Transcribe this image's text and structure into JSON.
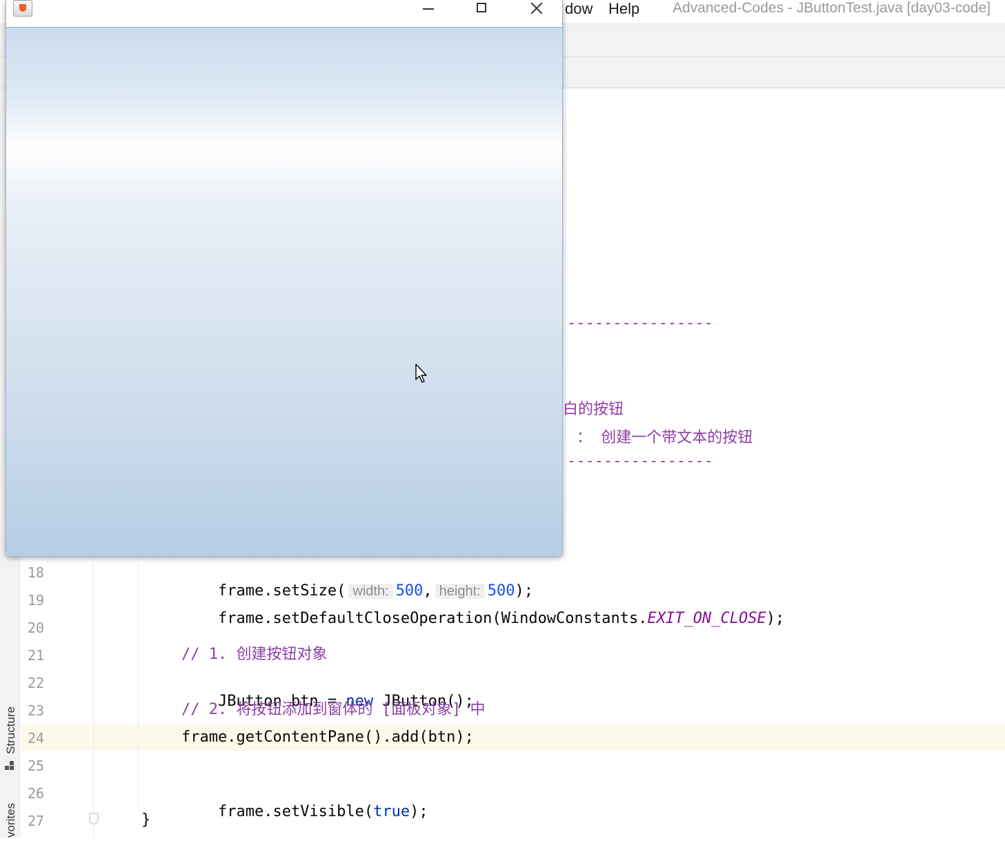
{
  "ide": {
    "menu_window": "dow",
    "menu_help": "Help",
    "title": "Advanced-Codes - JButtonTest.java [day03-code]",
    "side_tabs": {
      "structure": "Structure",
      "favorites": "vorites"
    }
  },
  "editor": {
    "partial_comments": {
      "dashes_top": "----------------",
      "line_a": "白的按钮",
      "line_b": "： 创建一个带文本的按钮",
      "dashes_bottom": "----------------"
    },
    "lines": [
      {
        "num": "18",
        "text": "frame.setSize(",
        "hint_width": "width:",
        "width_val": "500",
        "sep": ",",
        "hint_height": "height:",
        "height_val": "500",
        "end": ");"
      },
      {
        "num": "19",
        "text_a": "frame.setDefaultCloseOperation(WindowConstants.",
        "const": "EXIT_ON_CLOSE",
        "text_b": ");"
      },
      {
        "num": "20",
        "text": ""
      },
      {
        "num": "21",
        "comment": "// 1. 创建按钮对象"
      },
      {
        "num": "22",
        "text_a": "JButton btn = ",
        "kw": "new",
        "text_b": " JButton();"
      },
      {
        "num": "23",
        "comment": "// 2. 将按钮添加到窗体的 [面板对象] 中"
      },
      {
        "num": "24",
        "text": "frame.getContentPane().add(btn);"
      },
      {
        "num": "25",
        "text": ""
      },
      {
        "num": "26",
        "text_a": "frame.setVisible(",
        "kw": "true",
        "text_b": ");"
      },
      {
        "num": "27",
        "text": "}"
      }
    ],
    "current_line": "24"
  },
  "java_window": {
    "title": "",
    "controls": {
      "minimize": "minimize",
      "maximize": "maximize",
      "close": "close"
    }
  },
  "colors": {
    "keyword": "#0033b3",
    "number": "#1750eb",
    "constant": "#871094",
    "comment": "#8c3fa6",
    "current_line_bg": "#fcf9ea"
  }
}
